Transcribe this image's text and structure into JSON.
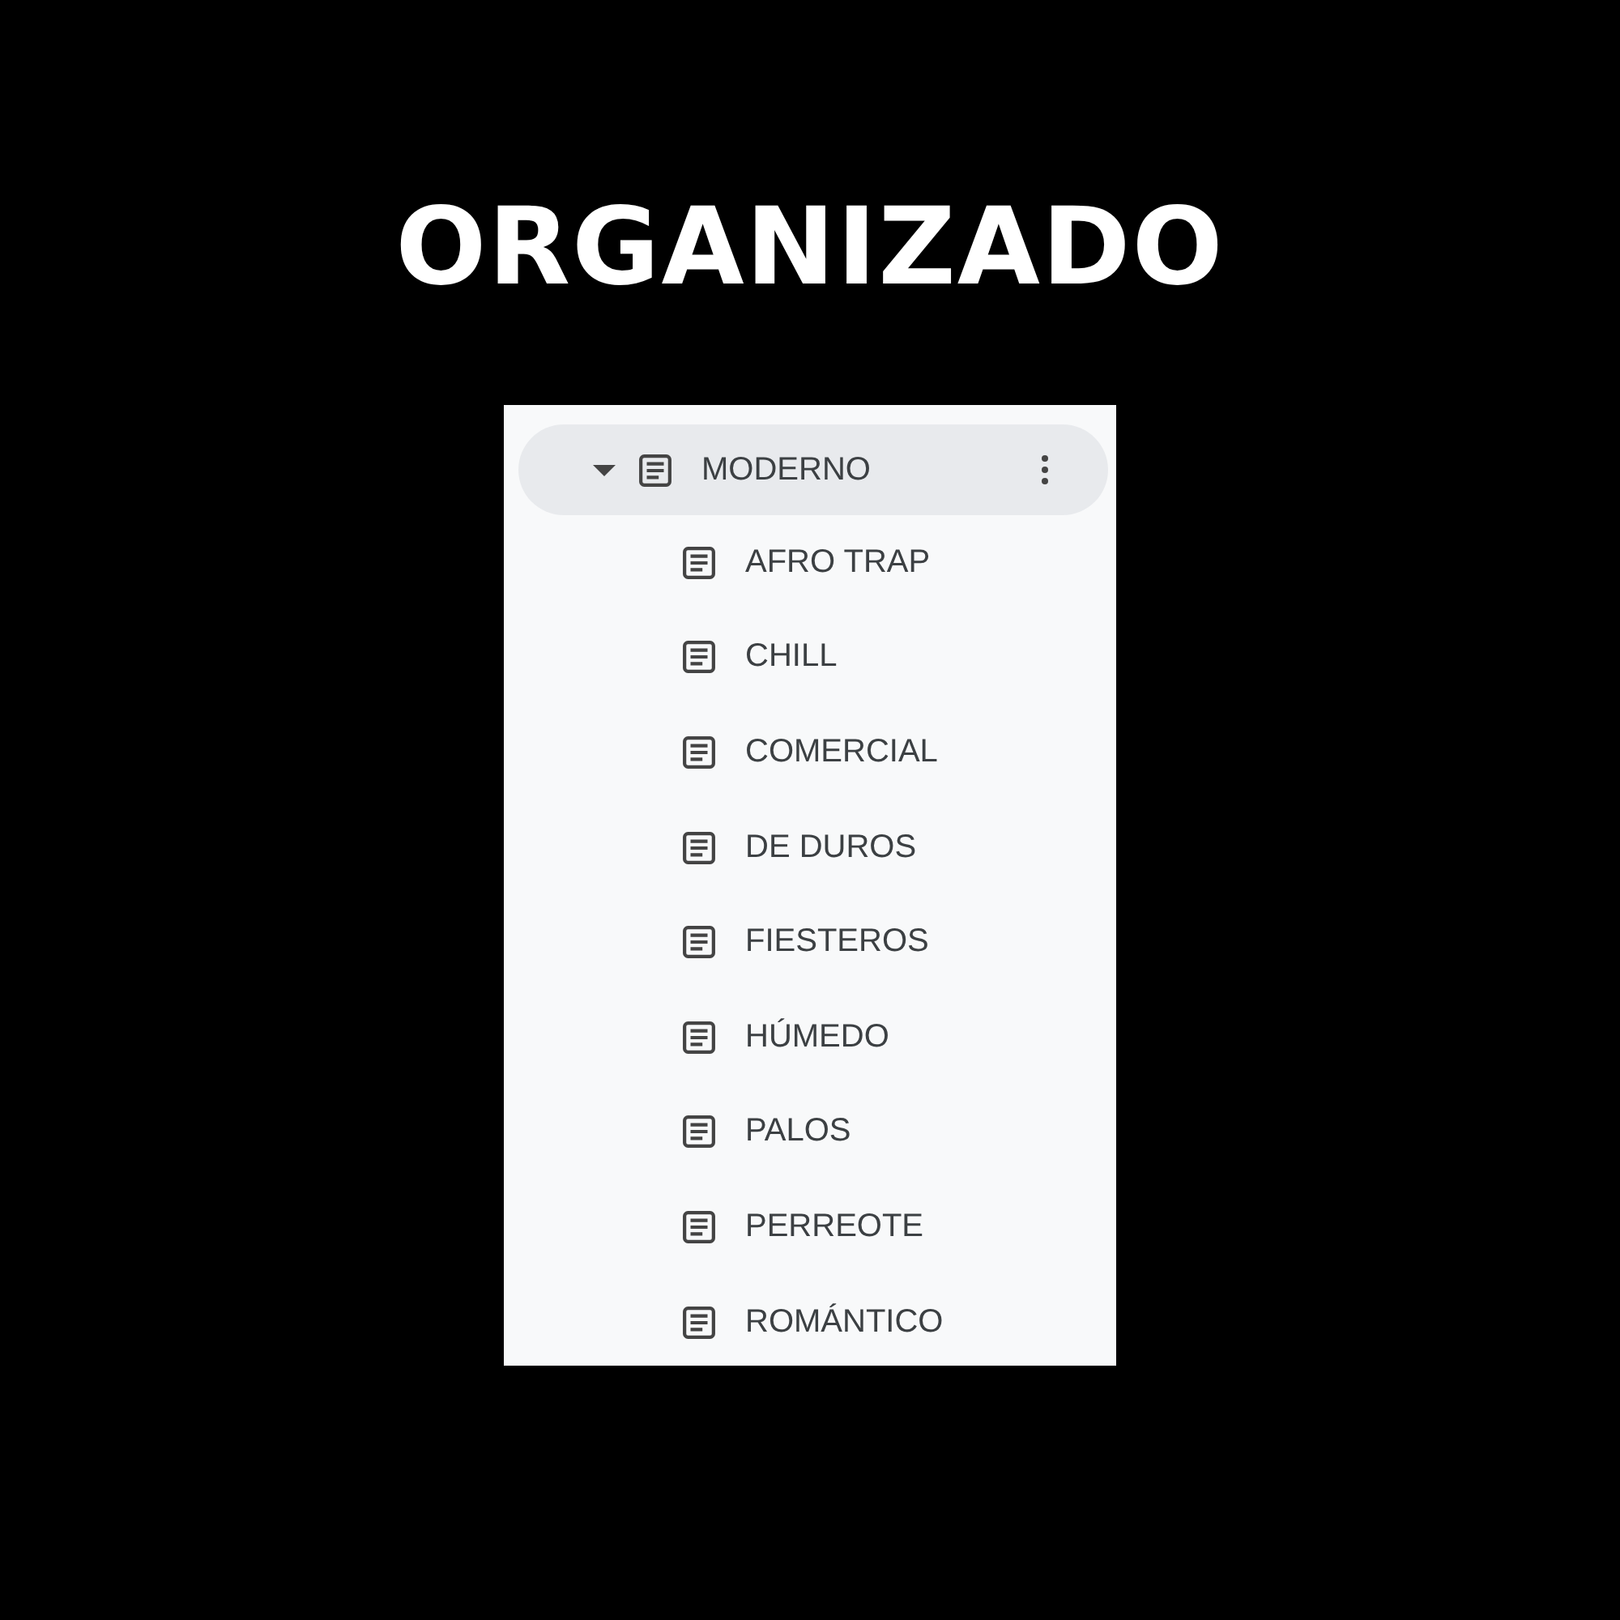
{
  "title": "ORGANIZADO",
  "outline": {
    "label": "MODERNO",
    "expanded": true,
    "selected": true,
    "children": [
      {
        "label": "AFRO TRAP",
        "selected": false
      },
      {
        "label": "CHILL",
        "selected": false
      },
      {
        "label": "COMERCIAL",
        "selected": false
      },
      {
        "label": "DE DUROS",
        "selected": false
      },
      {
        "label": "FIESTEROS",
        "selected": false
      },
      {
        "label": "HÚMEDO",
        "selected": false
      },
      {
        "label": "PALOS",
        "selected": false
      },
      {
        "label": "PERREOTE",
        "selected": false
      },
      {
        "label": "ROMÁNTICO",
        "selected": false
      }
    ]
  }
}
